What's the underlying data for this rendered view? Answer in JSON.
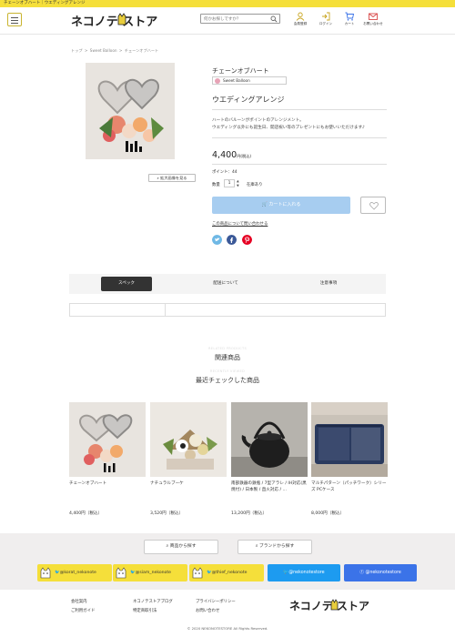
{
  "topbar": {
    "text": "チェーンオブハート｜ウエディングアレンジ"
  },
  "header": {
    "logo": "ネコノテ  ストア",
    "search_placeholder": "何かお探しですか？",
    "icons": [
      {
        "label": "会員登録",
        "icon": "user-icon"
      },
      {
        "label": "ログイン",
        "icon": "login-icon"
      },
      {
        "label": "カート",
        "icon": "cart-icon"
      },
      {
        "label": "お問い合わせ",
        "icon": "mail-icon"
      }
    ]
  },
  "breadcrumb": [
    "トップ",
    ">",
    "Sweet Balloon",
    ">",
    "チェーンオブハート"
  ],
  "product": {
    "name": "チェーンオブハート",
    "brand": "Sweet Balloon",
    "category": "ウエディングアレンジ",
    "description": "ハートのバルーンがポイントのアレンジメント。\nウエディング以外にも誕生日、開店祝い等のプレゼントにもお使いいただけます♪",
    "price": "4,400",
    "price_unit": "円(税込)",
    "points": "ポイント：44",
    "qty_label": "数量",
    "qty_value": "1",
    "stock": "在庫あり",
    "cart_label": "カートに入れる",
    "zoom_label": "拡大画像を見る",
    "inquiry": "この商品について問い合わせる"
  },
  "colors": {
    "accent_yellow": "#f5df3a",
    "cart_blue": "#a7cdf0",
    "twitter": "#1d9bf0",
    "facebook": "#3b73e8",
    "pinterest": "#e60023"
  },
  "tabs": [
    "スペック",
    "配送について",
    "注意事項"
  ],
  "related": {
    "en": "RELATED PRODUCTS",
    "jp": "関連商品"
  },
  "recent": {
    "en": "RECENTLY VIEWED",
    "jp": "最近チェックした商品",
    "items": [
      {
        "name": "チェーンオブハート",
        "price": "4,400円（税込）"
      },
      {
        "name": "ナチュラルブーケ",
        "price": "3,520円（税込）"
      },
      {
        "name": "南部鉄器の鉄瓶 / 7型アラレ / IH対応(黒焼付) / 日本製 / 直火対応 / ...",
        "price": "13,200円（税込）"
      },
      {
        "name": "マルチパターン（パッチワーク）シリーズ PCケース",
        "price": "8,000円（税込）"
      }
    ]
  },
  "find": {
    "product": "商品から探す",
    "brand": "ブランドから探す"
  },
  "social_links": [
    {
      "label": "@korat_nekonote"
    },
    {
      "label": "@siam_nekonote"
    },
    {
      "label": "@thief_nekonote"
    },
    {
      "label": "@nekonotestore"
    },
    {
      "label": "@nekonotestore"
    }
  ],
  "footer": {
    "col1": [
      "会社案内",
      "ご利用ガイド"
    ],
    "col2": [
      "ネコノテストアブログ",
      "特定商取引法"
    ],
    "col3": [
      "プライバシーポリシー",
      "お問い合わせ"
    ],
    "logo": "ネコノテ  ストア",
    "copyright": "© 2020 NEKONOTESTORE All Rights Reserved."
  }
}
